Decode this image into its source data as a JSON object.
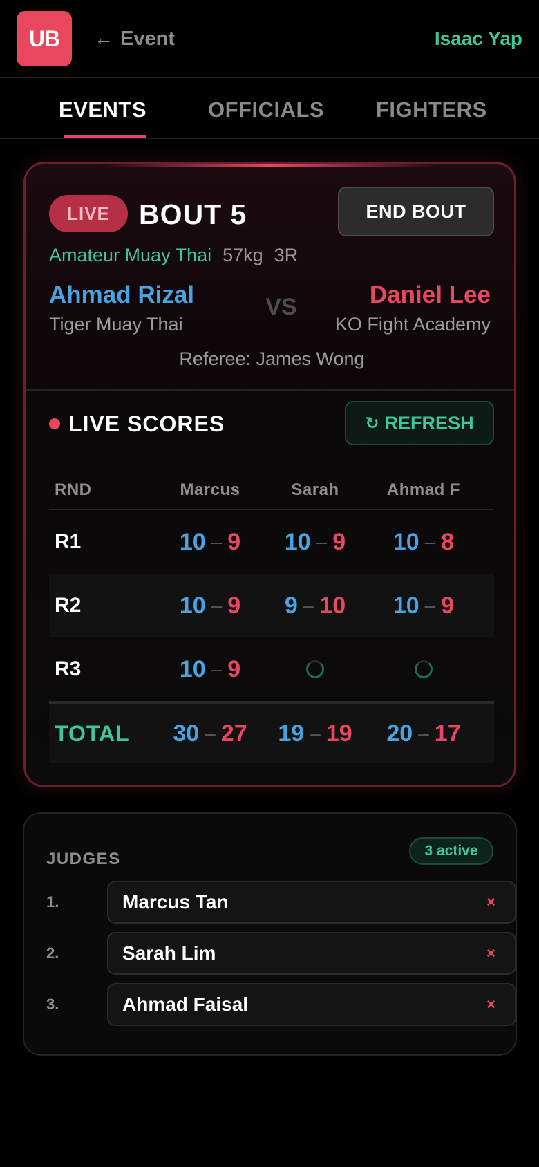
{
  "header": {
    "logo": "UB",
    "back_label": "Event",
    "user_name": "Isaac Yap"
  },
  "tabs": [
    {
      "label": "EVENTS",
      "active": true
    },
    {
      "label": "OFFICIALS",
      "active": false
    },
    {
      "label": "FIGHTERS",
      "active": false
    }
  ],
  "bout": {
    "status": "LIVE",
    "title": "BOUT 5",
    "end_label": "END BOUT",
    "class": "Amateur Muay Thai",
    "weight": "57kg",
    "rounds": "3R",
    "blue": {
      "name": "Ahmad Rizal",
      "gym": "Tiger Muay Thai"
    },
    "red": {
      "name": "Daniel Lee",
      "gym": "KO Fight Academy"
    },
    "vs": "VS",
    "referee": "Referee: James Wong"
  },
  "scores": {
    "title": "LIVE SCORES",
    "refresh_label": "REFRESH",
    "headers": [
      "RND",
      "Marcus",
      "Sarah",
      "Ahmad F"
    ],
    "rows": [
      {
        "round": "R1",
        "cells": [
          {
            "blue": "10",
            "red": "9"
          },
          {
            "blue": "10",
            "red": "9"
          },
          {
            "blue": "10",
            "red": "8"
          }
        ]
      },
      {
        "round": "R2",
        "cells": [
          {
            "blue": "10",
            "red": "9"
          },
          {
            "blue": "9",
            "red": "10"
          },
          {
            "blue": "10",
            "red": "9"
          }
        ]
      },
      {
        "round": "R3",
        "cells": [
          {
            "blue": "10",
            "red": "9"
          },
          {
            "pending": true
          },
          {
            "pending": true
          }
        ]
      }
    ],
    "total": {
      "label": "TOTAL",
      "cells": [
        {
          "blue": "30",
          "red": "27"
        },
        {
          "blue": "19",
          "red": "19"
        },
        {
          "blue": "20",
          "red": "17"
        }
      ]
    }
  },
  "judges": {
    "title": "JUDGES",
    "active_badge": "3 active",
    "items": [
      {
        "num": "1.",
        "name": "Marcus Tan"
      },
      {
        "num": "2.",
        "name": "Sarah Lim"
      },
      {
        "num": "3.",
        "name": "Ahmad Faisal"
      }
    ],
    "remove_glyph": "×"
  },
  "colors": {
    "accent_red": "#e8475f",
    "accent_green": "#3fc79a",
    "blue_corner": "#4aa3e0"
  }
}
